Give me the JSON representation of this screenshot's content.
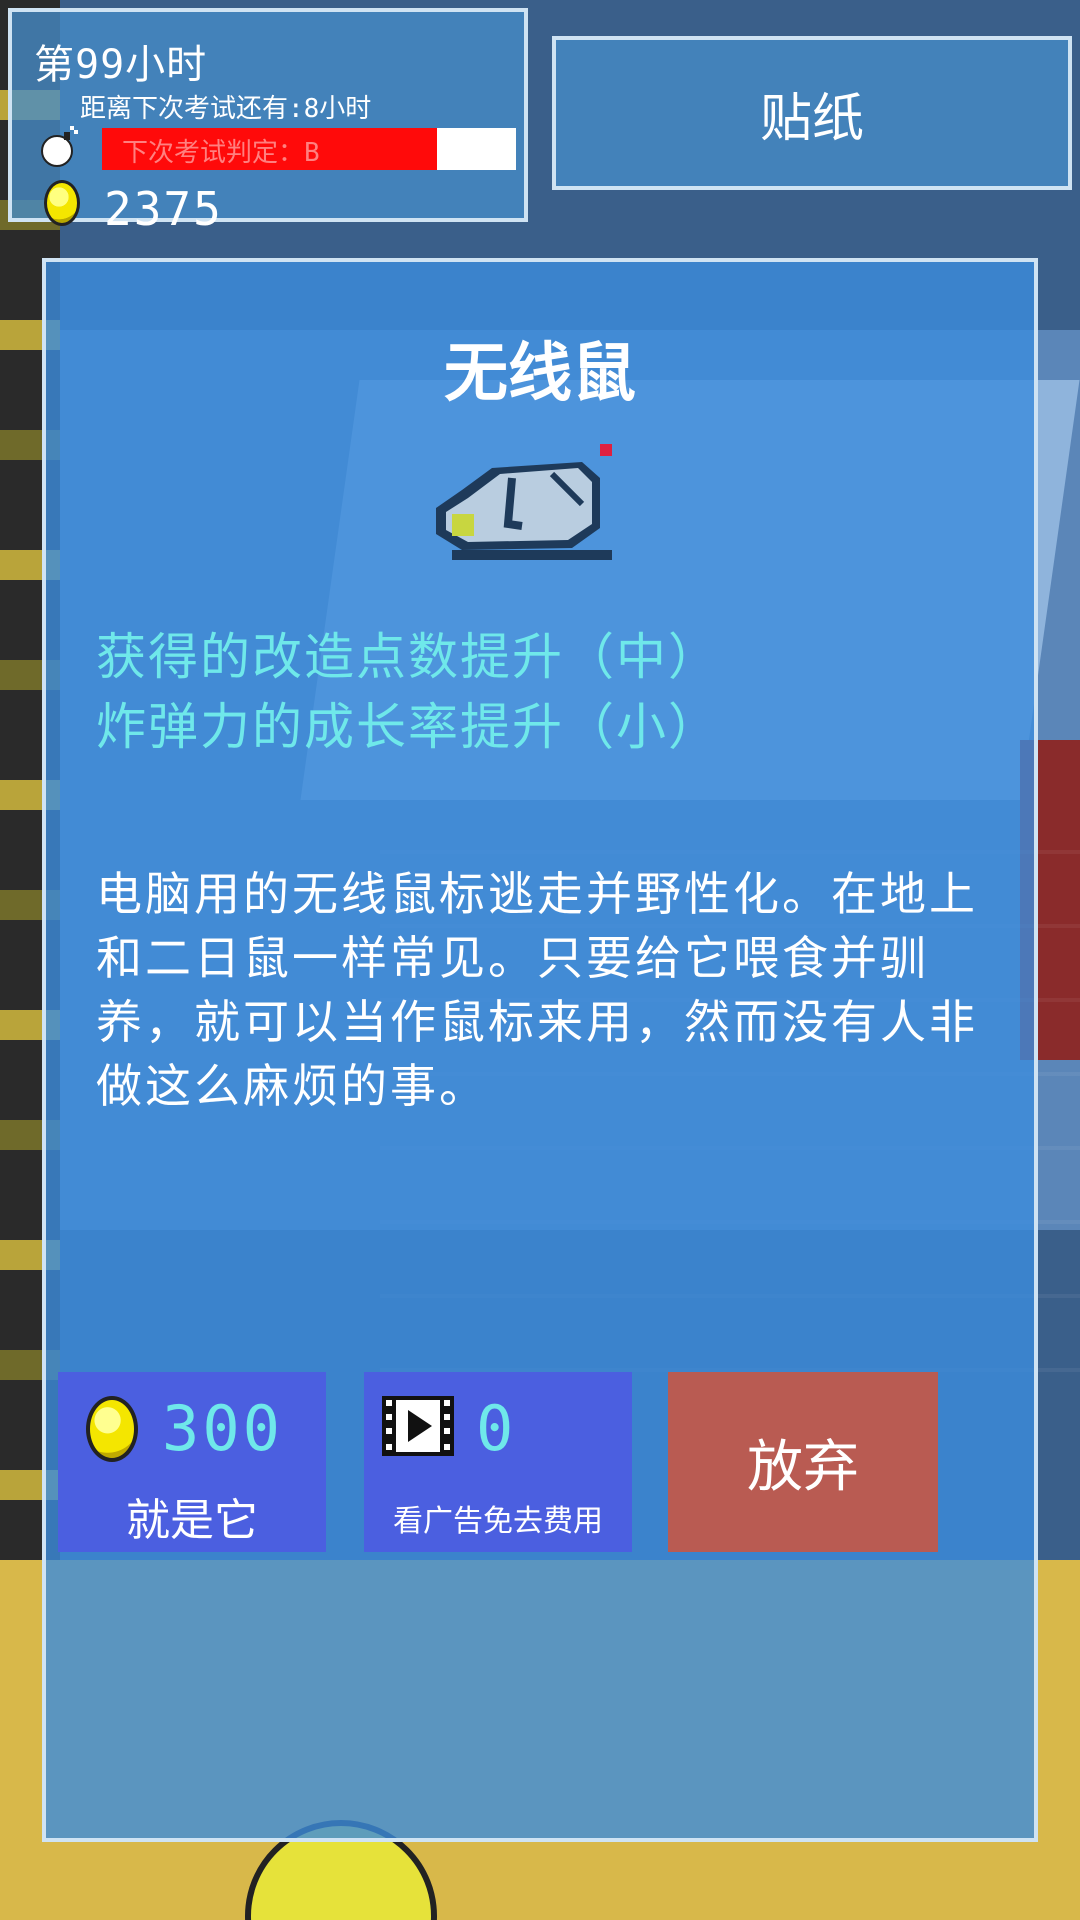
{
  "hud": {
    "hour_title": "第99小时",
    "exam_countdown": "距离下次考试还有:8小时",
    "grade_text": "下次考试判定：B",
    "grade_progress": 0.81,
    "coins": "2375"
  },
  "sticker_button": {
    "label": "贴纸"
  },
  "item": {
    "title": "无线鼠",
    "effects": [
      "获得的改造点数提升（中）",
      "炸弹力的成长率提升（小）"
    ],
    "description": "电脑用的无线鼠标逃走并野性化。在地上和二日鼠一样常见。只要给它喂食并驯养，就可以当作鼠标来用，然而没有人非做这么麻烦的事。"
  },
  "buttons": {
    "buy": {
      "price": "300",
      "label": "就是它",
      "icon": "coin-icon"
    },
    "ad": {
      "count": "0",
      "label": "看广告免去费用",
      "icon": "film-play-icon"
    },
    "quit": {
      "label": "放弃"
    }
  },
  "colors": {
    "panel": "#3c8cdc",
    "effect_text": "#6fe8ea",
    "button_blue": "#4b5fe0",
    "button_quit": "#b95b52",
    "grade_bar": "#ff0a0a"
  }
}
